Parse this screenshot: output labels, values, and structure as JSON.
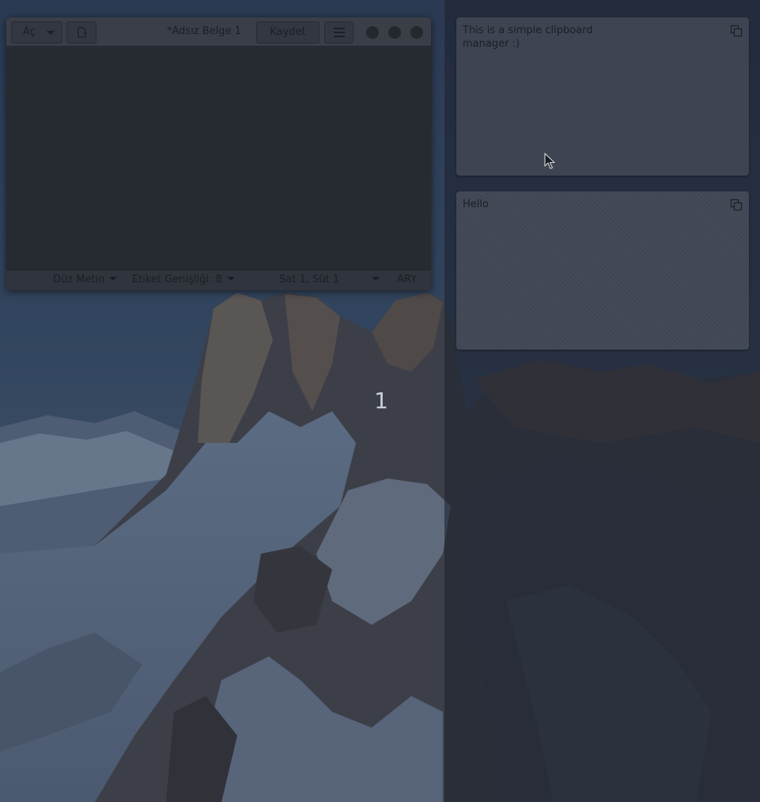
{
  "desktop": {
    "workspace_number": "1"
  },
  "editor": {
    "open_label": "Aç",
    "document_title": "*Adsız Belge 1",
    "save_label": "Kaydet",
    "text_content": "",
    "status": {
      "syntax": "Düz Metin",
      "tab_width": "Etiket Genişliği: 8",
      "cursor_position": "Sat 1, Süt 1",
      "insert_mode": "ARY"
    }
  },
  "clipboard": {
    "items": [
      {
        "text": "This is a simple clipboard manager :)",
        "icon": "copy-icon"
      },
      {
        "text": "Hello",
        "icon": "copy-icon"
      }
    ]
  },
  "colors": {
    "panel_dim": "#1e2430",
    "card_bg": "#404652",
    "editor_bg": "#262a31",
    "headerbar_bg": "#3a3e47"
  }
}
